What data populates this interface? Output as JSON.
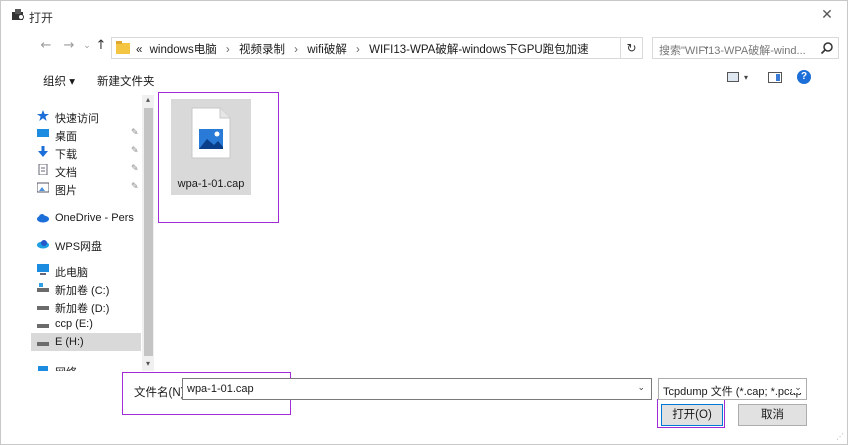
{
  "window": {
    "title": "打开",
    "close_glyph": "✕"
  },
  "nav": {
    "back": "←",
    "forward": "→",
    "history": "⌄",
    "up": "↑",
    "refresh": "↻"
  },
  "address": {
    "overflow": "«",
    "crumbs": [
      "windows电脑",
      "视频录制",
      "wifi破解",
      "WIFI13-WPA破解-windows下GPU跑包加速"
    ],
    "separator": "›",
    "dropdown": "⌄"
  },
  "search": {
    "placeholder": "搜索\"WIFI13-WPA破解-wind...",
    "icon": "search-icon"
  },
  "toolbar": {
    "organize": "组织 ▾",
    "new_folder": "新建文件夹",
    "view_arrow": "▾",
    "help": "?"
  },
  "sidebar": {
    "items": [
      {
        "label": "快速访问",
        "icon": "star-icon",
        "pinned": false
      },
      {
        "label": "桌面",
        "icon": "desktop-icon",
        "pinned": true
      },
      {
        "label": "下载",
        "icon": "download-icon",
        "pinned": true
      },
      {
        "label": "文档",
        "icon": "document-icon",
        "pinned": true
      },
      {
        "label": "图片",
        "icon": "picture-icon",
        "pinned": true
      },
      {
        "label": "OneDrive - Pers",
        "icon": "onedrive-icon",
        "pinned": false
      },
      {
        "label": "WPS网盘",
        "icon": "wps-cloud-icon",
        "pinned": false
      },
      {
        "label": "此电脑",
        "icon": "computer-icon",
        "pinned": false
      },
      {
        "label": "新加卷 (C:)",
        "icon": "drive-icon",
        "pinned": false
      },
      {
        "label": "新加卷 (D:)",
        "icon": "drive-icon",
        "pinned": false
      },
      {
        "label": "ccp (E:)",
        "icon": "drive-icon",
        "pinned": false
      },
      {
        "label": "E (H:)",
        "icon": "drive-icon",
        "pinned": false,
        "selected": true
      },
      {
        "label": "网络",
        "icon": "network-icon",
        "pinned": false
      }
    ],
    "pin_glyph": "📌",
    "scroll_up": "▴",
    "scroll_down": "▾"
  },
  "files": [
    {
      "name": "wpa-1-01.cap",
      "icon": "image-file-icon",
      "selected": true
    }
  ],
  "bottom": {
    "filename_label": "文件名(N):",
    "filename_value": "wpa-1-01.cap",
    "filename_dropdown": "⌄",
    "filetype_value": "Tcpdump 文件 (*.cap; *.pcap",
    "filetype_dropdown": "⌄",
    "open_button": "打开(O)",
    "cancel_button": "取消"
  },
  "colors": {
    "highlight": "#a12cd6",
    "accent": "#0078d7",
    "selected": "#d9d9d9"
  }
}
